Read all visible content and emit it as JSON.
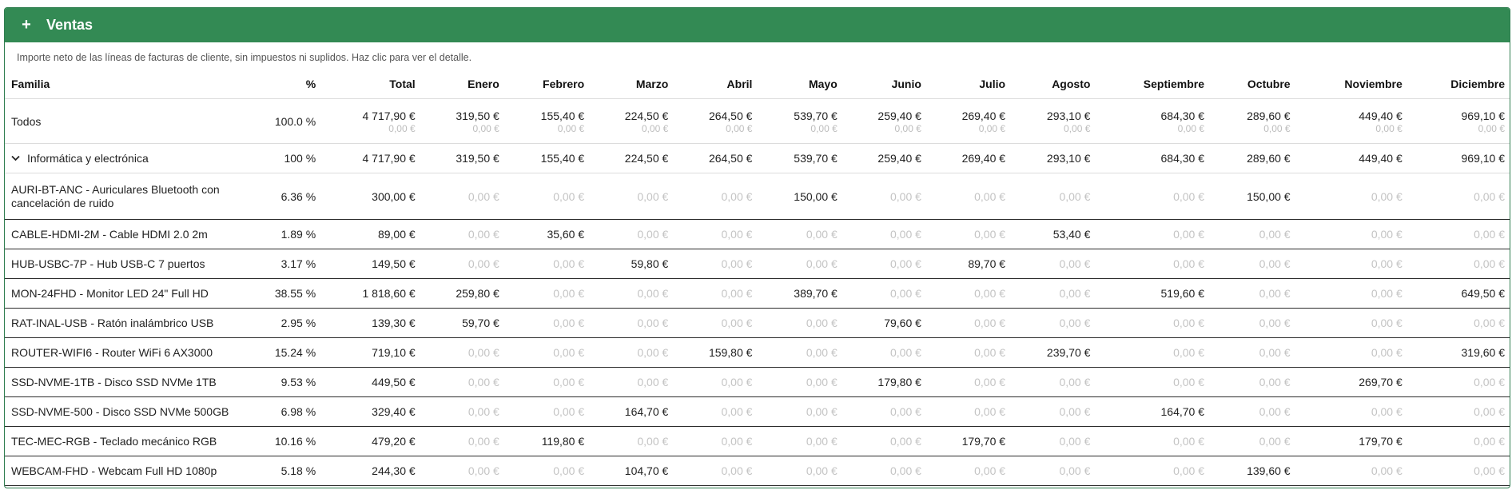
{
  "header": {
    "plus_icon": "+",
    "title": "Ventas"
  },
  "description": "Importe neto de las líneas de facturas de cliente, sin impuestos ni suplidos. Haz clic para ver el detalle.",
  "columns": [
    "Familia",
    "%",
    "Total",
    "Enero",
    "Febrero",
    "Marzo",
    "Abril",
    "Mayo",
    "Junio",
    "Julio",
    "Agosto",
    "Septiembre",
    "Octubre",
    "Noviembre",
    "Diciembre"
  ],
  "total_row": {
    "label": "Todos",
    "percent": "100.0 %",
    "values": [
      "4 717,90 €",
      "319,50 €",
      "155,40 €",
      "224,50 €",
      "264,50 €",
      "539,70 €",
      "259,40 €",
      "269,40 €",
      "293,10 €",
      "684,30 €",
      "289,60 €",
      "449,40 €",
      "969,10 €"
    ],
    "sub_values": [
      "0,00 €",
      "0,00 €",
      "0,00 €",
      "0,00 €",
      "0,00 €",
      "0,00 €",
      "0,00 €",
      "0,00 €",
      "0,00 €",
      "0,00 €",
      "0,00 €",
      "0,00 €",
      "0,00 €"
    ]
  },
  "group_row": {
    "label": "Informática y electrónica",
    "expand_icon": "chevron-down-icon",
    "percent": "100 %",
    "values": [
      "4 717,90 €",
      "319,50 €",
      "155,40 €",
      "224,50 €",
      "264,50 €",
      "539,70 €",
      "259,40 €",
      "269,40 €",
      "293,10 €",
      "684,30 €",
      "289,60 €",
      "449,40 €",
      "969,10 €"
    ]
  },
  "items": [
    {
      "label": "AURI-BT-ANC - Auriculares Bluetooth con cancelación de ruido",
      "percent": "6.36 %",
      "values": [
        "300,00 €",
        "0,00 €",
        "0,00 €",
        "0,00 €",
        "0,00 €",
        "150,00 €",
        "0,00 €",
        "0,00 €",
        "0,00 €",
        "0,00 €",
        "150,00 €",
        "0,00 €",
        "0,00 €"
      ]
    },
    {
      "label": "CABLE-HDMI-2M - Cable HDMI 2.0 2m",
      "percent": "1.89 %",
      "values": [
        "89,00 €",
        "0,00 €",
        "35,60 €",
        "0,00 €",
        "0,00 €",
        "0,00 €",
        "0,00 €",
        "0,00 €",
        "53,40 €",
        "0,00 €",
        "0,00 €",
        "0,00 €",
        "0,00 €"
      ]
    },
    {
      "label": "HUB-USBC-7P - Hub USB-C 7 puertos",
      "percent": "3.17 %",
      "values": [
        "149,50 €",
        "0,00 €",
        "0,00 €",
        "59,80 €",
        "0,00 €",
        "0,00 €",
        "0,00 €",
        "89,70 €",
        "0,00 €",
        "0,00 €",
        "0,00 €",
        "0,00 €",
        "0,00 €"
      ]
    },
    {
      "label": "MON-24FHD - Monitor LED 24\" Full HD",
      "percent": "38.55 %",
      "values": [
        "1 818,60 €",
        "259,80 €",
        "0,00 €",
        "0,00 €",
        "0,00 €",
        "389,70 €",
        "0,00 €",
        "0,00 €",
        "0,00 €",
        "519,60 €",
        "0,00 €",
        "0,00 €",
        "649,50 €"
      ]
    },
    {
      "label": "RAT-INAL-USB - Ratón inalámbrico USB",
      "percent": "2.95 %",
      "values": [
        "139,30 €",
        "59,70 €",
        "0,00 €",
        "0,00 €",
        "0,00 €",
        "0,00 €",
        "79,60 €",
        "0,00 €",
        "0,00 €",
        "0,00 €",
        "0,00 €",
        "0,00 €",
        "0,00 €"
      ]
    },
    {
      "label": "ROUTER-WIFI6 - Router WiFi 6 AX3000",
      "percent": "15.24 %",
      "values": [
        "719,10 €",
        "0,00 €",
        "0,00 €",
        "0,00 €",
        "159,80 €",
        "0,00 €",
        "0,00 €",
        "0,00 €",
        "239,70 €",
        "0,00 €",
        "0,00 €",
        "0,00 €",
        "319,60 €"
      ]
    },
    {
      "label": "SSD-NVME-1TB - Disco SSD NVMe 1TB",
      "percent": "9.53 %",
      "values": [
        "449,50 €",
        "0,00 €",
        "0,00 €",
        "0,00 €",
        "0,00 €",
        "0,00 €",
        "179,80 €",
        "0,00 €",
        "0,00 €",
        "0,00 €",
        "0,00 €",
        "269,70 €",
        "0,00 €"
      ]
    },
    {
      "label": "SSD-NVME-500 - Disco SSD NVMe 500GB",
      "percent": "6.98 %",
      "values": [
        "329,40 €",
        "0,00 €",
        "0,00 €",
        "164,70 €",
        "0,00 €",
        "0,00 €",
        "0,00 €",
        "0,00 €",
        "0,00 €",
        "164,70 €",
        "0,00 €",
        "0,00 €",
        "0,00 €"
      ]
    },
    {
      "label": "TEC-MEC-RGB - Teclado mecánico RGB",
      "percent": "10.16 %",
      "values": [
        "479,20 €",
        "0,00 €",
        "119,80 €",
        "0,00 €",
        "0,00 €",
        "0,00 €",
        "0,00 €",
        "179,70 €",
        "0,00 €",
        "0,00 €",
        "0,00 €",
        "179,70 €",
        "0,00 €"
      ]
    },
    {
      "label": "WEBCAM-FHD - Webcam Full HD 1080p",
      "percent": "5.18 %",
      "values": [
        "244,30 €",
        "0,00 €",
        "0,00 €",
        "104,70 €",
        "0,00 €",
        "0,00 €",
        "0,00 €",
        "0,00 €",
        "0,00 €",
        "0,00 €",
        "139,60 €",
        "0,00 €",
        "0,00 €"
      ]
    }
  ],
  "colors": {
    "header_bg": "#338a54",
    "zero_text": "#c4c4c4"
  }
}
